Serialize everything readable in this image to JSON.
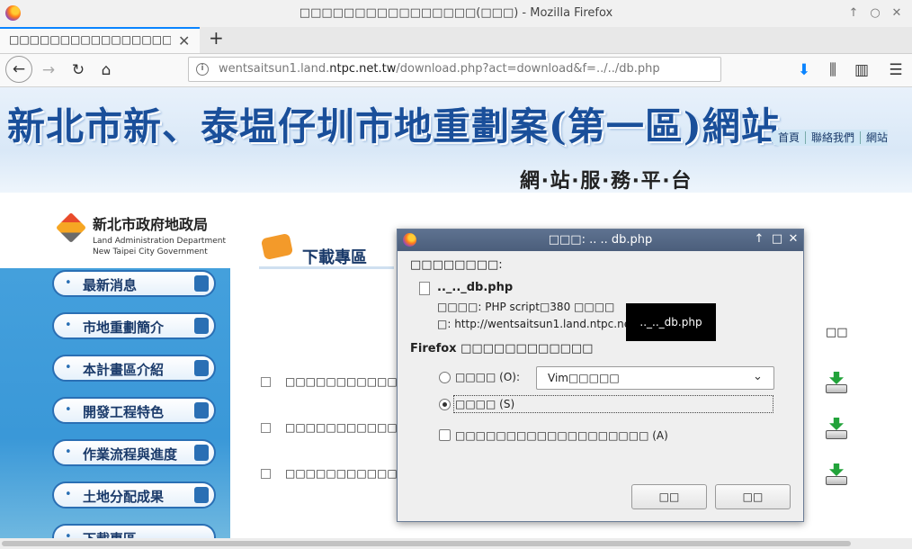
{
  "window": {
    "title": "□□□□□□□□□□□□□□□□(□□□) - Mozilla Firefox",
    "controls": [
      "↑",
      "○",
      "✕"
    ]
  },
  "tab": {
    "title": "□□□□□□□□□□□□□□□□□□□",
    "close": "✕",
    "new_tab": "+"
  },
  "nav": {
    "back": "←",
    "forward": "→",
    "reload": "↻",
    "home": "⌂",
    "url_prefix": "wentsaitsun1.land.",
    "url_domain": "ntpc.net.tw",
    "url_path": "/download.php?act=download&f=../../db.php",
    "download": "⬇",
    "library": "⫼",
    "sidebar": "▥",
    "menu": "☰"
  },
  "page": {
    "banner_title": "新北市新、泰塭仔圳市地重劃案(第一區)網站",
    "banner_subtitle": "網‧站‧服‧務‧平‧台",
    "top_links": [
      "首頁",
      "聯絡我們",
      "網站"
    ],
    "dept_name": "新北市政府地政局",
    "dept_en_1": "Land Administration Department",
    "dept_en_2": "New Taipei City Government",
    "menu": [
      {
        "label": "最新消息"
      },
      {
        "label": "市地重劃簡介"
      },
      {
        "label": "本計畫區介紹"
      },
      {
        "label": "開發工程特色"
      },
      {
        "label": "作業流程與進度"
      },
      {
        "label": "土地分配成果"
      },
      {
        "label": "下載專區"
      }
    ],
    "menu_bullet": "•",
    "section_title": "下載專區",
    "column_header": "□□",
    "rows": [
      {
        "text": "□□□□□□□□□□□□□□□□"
      },
      {
        "text": "□□□□□□□□□□□□□□□□"
      },
      {
        "text": "□□□□□□□□□□□□□□□□"
      }
    ]
  },
  "dialog": {
    "title": "□□□: .. .. db.php",
    "controls": [
      "↑",
      "□",
      "✕"
    ],
    "intro": "□□□□□□□□:",
    "file_name": ".._.._db.php",
    "file_type": "□□□□: PHP script□380 □□□□",
    "file_from": "□: http://wentsaitsun1.land.ntpc.net.tw",
    "tooltip": ".._.._db.php",
    "heading": "Firefox □□□□□□□□□□□□",
    "open_with_label": "□□□□ (O):",
    "open_with_app": "Vim□□□□□",
    "save_label": "□□□□ (S)",
    "remember_label": "□□□□□□□□□□□□□□□□□□□ (A)",
    "ok_label": "□□",
    "cancel_label": "□□"
  }
}
